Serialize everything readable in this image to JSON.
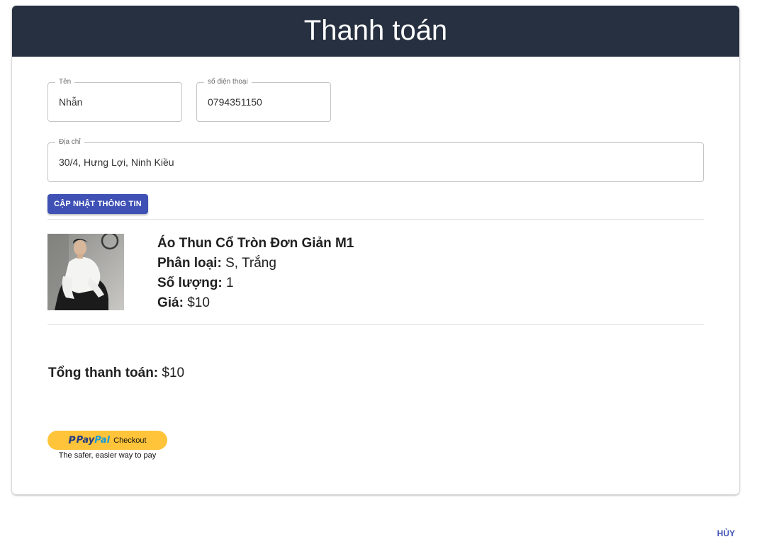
{
  "header": {
    "title": "Thanh toán"
  },
  "form": {
    "name": {
      "label": "Tên",
      "value": "Nhẫn"
    },
    "phone": {
      "label": "số điện thoại",
      "value": "0794351150"
    },
    "address": {
      "label": "Địa chỉ",
      "value": "30/4, Hưng Lợi, Ninh Kiều"
    },
    "update_button": "CẬP NHẬT THÔNG TIN"
  },
  "product": {
    "name": "Áo Thun Cổ Tròn Đơn Giản M1",
    "variant_label": "Phân loại:",
    "variant_value": "S, Trắng",
    "quantity_label": "Số lượng:",
    "quantity_value": "1",
    "price_label": "Giá:",
    "price_value": "$10"
  },
  "total": {
    "label": "Tổng thanh toán:",
    "value": "$10"
  },
  "paypal": {
    "brand_pay": "Pay",
    "brand_pal": "Pal",
    "button_label": "Checkout",
    "tagline": "The safer, easier way to pay"
  },
  "footer": {
    "cancel_label": "HỦY"
  },
  "colors": {
    "header_bg": "#263040",
    "primary": "#3f51b5",
    "paypal_yellow": "#ffc439"
  }
}
